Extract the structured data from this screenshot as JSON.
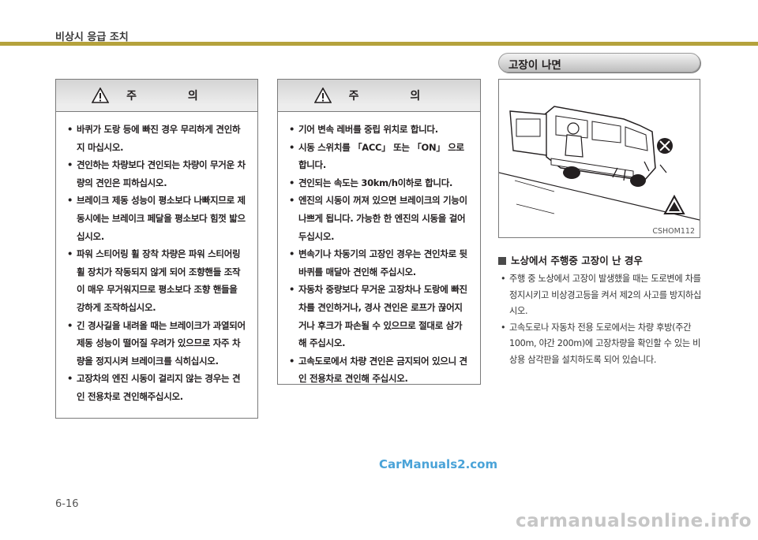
{
  "header": {
    "title": "비상시 응급 조치"
  },
  "caution_left": {
    "title": "주 의",
    "items": [
      "바퀴가 도랑 등에 빠진 경우 무리하게 견인하지 마십시오.",
      "견인하는 차량보다 견인되는 차량이 무거운 차량의 견인은 피하십시오.",
      "브레이크 제동 성능이 평소보다 나빠지므로 제동시에는 브레이크 페달을 평소보다 힘껏 밟으십시오.",
      "파워 스티어링 휠 장착 차량은 파워 스티어링 휠 장치가 작동되지 않게 되어 조향핸들 조작이 매우 무거워지므로 평소보다 조향 핸들을 강하게 조작하십시오.",
      "긴 경사길을 내려올 때는 브레이크가 과열되어 제동 성능이 떨어질 우려가 있으므로 자주 차량을 정지시켜 브레이크를 식히십시오.",
      "고장차의 엔진 시동이 걸리지 않는 경우는 견인 전용차로 견인해주십시오."
    ]
  },
  "caution_right": {
    "title": "주 의",
    "items": [
      "기어 변속 레버를 중립 위치로 합니다.",
      "시동 스위치를 「ACC」 또는 「ON」 으로 합니다.",
      "견인되는 속도는 30km/h이하로 합니다.",
      "엔진의 시동이 꺼져 있으면 브레이크의 기능이 나쁘게 됩니다. 가능한 한 엔진의 시동을 걸어 두십시오.",
      "변속기나 차동기의 고장인 경우는 견인차로 뒷 바퀴를 매달아 견인해 주십시오.",
      "자동차 중량보다 무거운 고장차나 도랑에 빠진 차를 견인하거나, 경사 견인은 로프가 끊어지거나 후크가 파손될 수 있으므로 절대로 삼가해 주십시오.",
      "고속도로에서 차량 견인은 금지되어 있으니 견인 전용차로 견인해 주십시오."
    ]
  },
  "section": {
    "title": "고장이 나면",
    "figure_code": "CSHOM112",
    "subheading": "노상에서 주행중 고장이 난 경우",
    "items": [
      "주행 중 노상에서 고장이 발생했을 때는 도로변에 차를 정지시키고 비상경고등을 켜서 제2의 사고를 방지하십시오.",
      "고속도로나 자동차 전용 도로에서는 차량 후방(주간 100m, 야간 200m)에 고장차량을 확인할 수 있는 비상용 삼각판을 설치하도록 되어 있습니다."
    ]
  },
  "footer": {
    "page_number": "6-16",
    "watermark_center": "CarManuals2.com",
    "watermark_bottom": "carmanualsonline.info"
  }
}
